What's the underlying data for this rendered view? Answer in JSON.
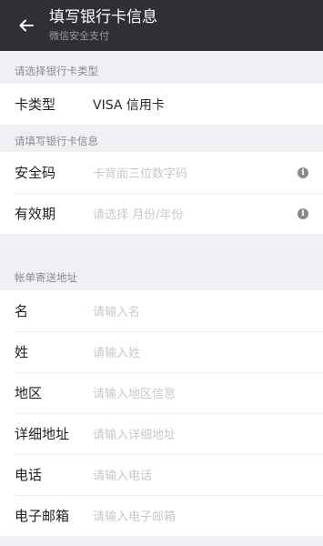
{
  "header": {
    "title": "填写银行卡信息",
    "subtitle": "微信安全支付"
  },
  "card_type_section": {
    "header": "请选择银行卡类型",
    "row": {
      "label": "卡类型",
      "value": "VISA 信用卡"
    }
  },
  "card_info_section": {
    "header": "请填写银行卡信息",
    "rows": [
      {
        "label": "安全码",
        "placeholder": "卡背面三位数字码"
      },
      {
        "label": "有效期",
        "placeholder": "请选择 月份/年份"
      }
    ]
  },
  "billing_section": {
    "header": "帐单寄送地址",
    "rows": [
      {
        "label": "名",
        "placeholder": "请输入名"
      },
      {
        "label": "姓",
        "placeholder": "请输入姓"
      },
      {
        "label": "地区",
        "placeholder": "请输入地区信息"
      },
      {
        "label": "详细地址",
        "placeholder": "请输入详细地址"
      },
      {
        "label": "电话",
        "placeholder": "请输入电话"
      },
      {
        "label": "电子邮箱",
        "placeholder": "请输入电子邮箱"
      }
    ]
  },
  "colors": {
    "topbar": "#2f2f35",
    "page_bg": "#efeff4",
    "placeholder": "#c8c8cc"
  },
  "icons": {
    "back": "back-arrow-icon",
    "info": "info-icon"
  }
}
